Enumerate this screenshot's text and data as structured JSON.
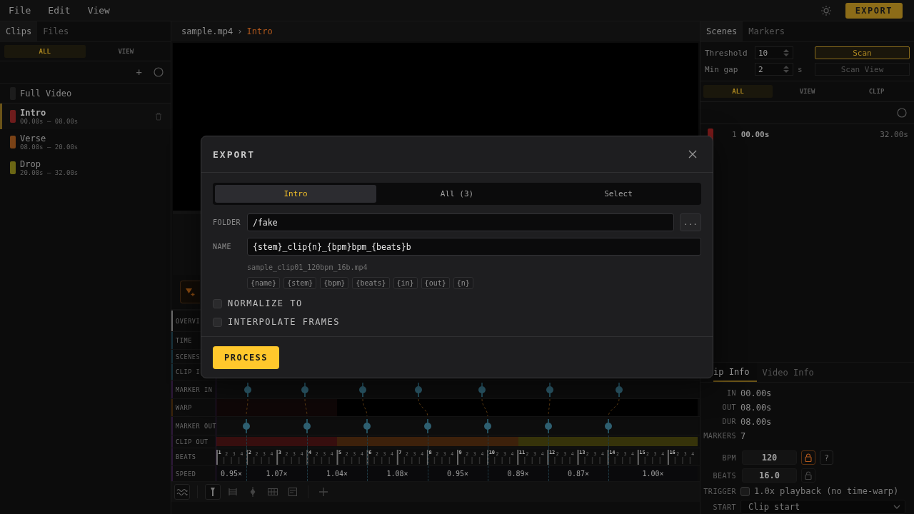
{
  "menu": [
    "File",
    "Edit",
    "View"
  ],
  "export_button": "EXPORT",
  "sidebar": {
    "tabs": [
      {
        "label": "Clips",
        "selected": true
      },
      {
        "label": "Files",
        "selected": false
      }
    ],
    "filters": [
      {
        "label": "ALL",
        "selected": true
      },
      {
        "label": "VIEW",
        "selected": false
      }
    ],
    "add_button": "+",
    "clips": [
      {
        "name": "Full Video",
        "color": "#1c1c1c",
        "selected": false
      },
      {
        "name": "Intro",
        "range": "00.00s – 08.00s",
        "color": "#6e1c1c",
        "selected": true
      },
      {
        "name": "Verse",
        "range": "08.00s – 20.00s",
        "color": "#7a4216",
        "selected": false
      },
      {
        "name": "Drop",
        "range": "20.00s – 32.00s",
        "color": "#6b6614",
        "selected": false
      }
    ]
  },
  "breadcrumb": {
    "file": "sample.mp4",
    "separator": "›",
    "clip": "Intro"
  },
  "timeline": {
    "labels": [
      "OVERVI",
      "TIME",
      "SCENES",
      "CLIP I",
      "MARKER IN",
      "WARP",
      "MARKER OUT",
      "CLIP OUT",
      "BEATS",
      "SPEED"
    ],
    "bars": [
      {
        "bar": "1",
        "ticks": [
          "2",
          "3",
          "4"
        ]
      },
      {
        "bar": "2",
        "ticks": [
          "2",
          "3",
          "4"
        ]
      },
      {
        "bar": "3",
        "ticks": [
          "2",
          "3",
          "4"
        ]
      },
      {
        "bar": "4",
        "ticks": [
          "2",
          "3",
          "4"
        ]
      },
      {
        "bar": "5",
        "ticks": [
          "2",
          "3",
          "4"
        ]
      },
      {
        "bar": "6",
        "ticks": [
          "2",
          "3",
          "4"
        ]
      },
      {
        "bar": "7",
        "ticks": [
          "2",
          "3",
          "4"
        ]
      },
      {
        "bar": "8",
        "ticks": [
          "2",
          "3",
          "4"
        ]
      },
      {
        "bar": "9",
        "ticks": [
          "2",
          "3",
          "4"
        ]
      },
      {
        "bar": "10",
        "ticks": [
          "2",
          "3",
          "4"
        ]
      },
      {
        "bar": "11",
        "ticks": [
          "2",
          "3",
          "4"
        ]
      },
      {
        "bar": "12",
        "ticks": [
          "2",
          "3",
          "4"
        ]
      },
      {
        "bar": "13",
        "ticks": [
          "2",
          "3",
          "4"
        ]
      },
      {
        "bar": "14",
        "ticks": [
          "2",
          "3",
          "4"
        ]
      },
      {
        "bar": "15",
        "ticks": [
          "2",
          "3",
          "4"
        ]
      },
      {
        "bar": "16",
        "ticks": [
          "2",
          "3",
          "4"
        ]
      }
    ],
    "speeds": [
      "0.95×",
      "1.07×",
      "1.04×",
      "1.08×",
      "0.95×",
      "0.89×",
      "0.87×",
      "1.00×"
    ]
  },
  "scenes_panel": {
    "tabs": [
      {
        "label": "Scenes",
        "selected": true
      },
      {
        "label": "Markers",
        "selected": false
      }
    ],
    "threshold": {
      "label": "Threshold",
      "value": "10"
    },
    "min_gap": {
      "label": "Min gap",
      "value": "2",
      "unit": "s"
    },
    "scan_button": "Scan",
    "scan_view_button": {
      "label": "Scan View",
      "disabled": true
    },
    "filters": [
      {
        "label": "ALL",
        "selected": true
      },
      {
        "label": "VIEW",
        "selected": false
      },
      {
        "label": "CLIP",
        "selected": false
      }
    ],
    "scenes": [
      {
        "index": "1",
        "start": "00.00s",
        "end": "32.00s",
        "color": "#7a1a1a"
      }
    ]
  },
  "info_panel": {
    "tabs": [
      {
        "label": "ip Info",
        "selected": true
      },
      {
        "label": "Video Info",
        "selected": false
      }
    ],
    "fields": [
      {
        "label": "IN",
        "value": "00.00s"
      },
      {
        "label": "OUT",
        "value": "08.00s"
      },
      {
        "label": "DUR",
        "value": "08.00s"
      },
      {
        "label": "MARKERS",
        "value": "7"
      }
    ],
    "bpm": {
      "label": "BPM",
      "value": "120",
      "locked": true
    },
    "help_button": "?",
    "beats": {
      "label": "BEATS",
      "value": "16.0",
      "locked": false
    },
    "trigger": {
      "label": "TRIGGER",
      "checked": false,
      "text": "1.0x playback (no time-warp)"
    },
    "start": {
      "label": "START",
      "value": "Clip start"
    }
  },
  "modal": {
    "title": "EXPORT",
    "tabs": [
      {
        "label": "Intro",
        "selected": true
      },
      {
        "label": "All (3)",
        "selected": false
      },
      {
        "label": "Select",
        "selected": false
      }
    ],
    "folder": {
      "label": "FOLDER",
      "value": "/fake"
    },
    "browse_button": "...",
    "name": {
      "label": "NAME",
      "value": "{stem}_clip{n}_{bpm}bpm_{beats}b"
    },
    "preview": "sample_clip01_120bpm_16b.mp4",
    "tokens": [
      "{name}",
      "{stem}",
      "{bpm}",
      "{beats}",
      "{in}",
      "{out}",
      "{n}"
    ],
    "options": [
      {
        "label": "NORMALIZE TO",
        "checked": false
      },
      {
        "label": "INTERPOLATE FRAMES",
        "checked": false
      }
    ],
    "process_button": "PROCESS"
  }
}
